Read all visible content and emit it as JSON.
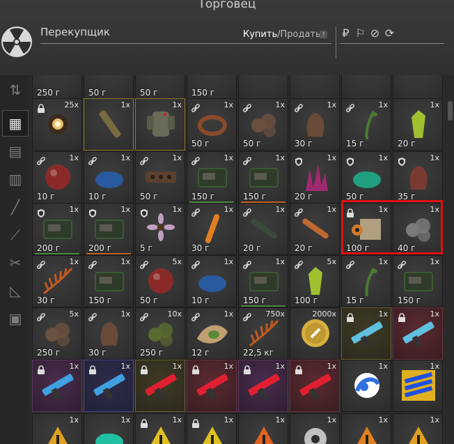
{
  "window": {
    "title": "Торговец"
  },
  "header": {
    "trader_name": "Перекупщик",
    "mode_buy": "Купить",
    "mode_sep": "/",
    "mode_sell": "Продать",
    "help": "?",
    "currencies": [
      "₽",
      "⚐",
      "⊘",
      "⟳"
    ]
  },
  "sidebar": {
    "items": [
      {
        "icon": "sort-icon",
        "active": false
      },
      {
        "icon": "grid-all-icon",
        "active": true
      },
      {
        "icon": "backpack-icon",
        "active": false
      },
      {
        "icon": "armor-icon",
        "active": false
      },
      {
        "icon": "rifle-icon",
        "active": false
      },
      {
        "icon": "knife-icon",
        "active": false
      },
      {
        "icon": "tools-icon",
        "active": false
      },
      {
        "icon": "attachments-icon",
        "active": false
      },
      {
        "icon": "crate-icon",
        "active": false
      }
    ]
  },
  "grid": {
    "rows": [
      [
        {
          "price": "250 г"
        },
        {
          "price": "50 г"
        },
        {
          "price": "50 г"
        },
        {
          "price": "150 г"
        },
        {
          "price": ""
        },
        {
          "price": ""
        },
        {
          "price": ""
        },
        {
          "price": ""
        }
      ],
      [
        {
          "qty": "25x",
          "price": "",
          "badge": "lock",
          "art": "orb",
          "color": "#e8c070"
        },
        {
          "qty": "1x",
          "price": "",
          "badge": "",
          "art": "rod",
          "color": "#7a6a40",
          "tone": "y"
        },
        {
          "qty": "1x",
          "price": "",
          "badge": "",
          "art": "armor",
          "color": "#6a6a58",
          "tone": "y"
        },
        {
          "qty": "1x",
          "price": "50 г",
          "badge": "link",
          "art": "ring",
          "color": "#8a4a2a"
        },
        {
          "qty": "1x",
          "price": "50 г",
          "badge": "link",
          "art": "rocks",
          "color": "#6a5040"
        },
        {
          "qty": "1x",
          "price": "30 г",
          "badge": "link",
          "art": "lump",
          "color": "#6a4a38"
        },
        {
          "qty": "1x",
          "price": "15 г",
          "badge": "link",
          "art": "sprout",
          "color": "#4a7a30"
        },
        {
          "qty": "1x",
          "price": "20 г",
          "badge": "",
          "art": "crystal",
          "color": "#a0c030"
        }
      ],
      [
        {
          "qty": "1x",
          "price": "10 г",
          "badge": "link",
          "art": "sphere",
          "color": "#8a2a28"
        },
        {
          "qty": "1x",
          "price": "10 г",
          "badge": "link",
          "art": "moss",
          "color": "#2a5aa0"
        },
        {
          "qty": "1x",
          "price": "50 г",
          "badge": "link",
          "art": "slab",
          "color": "#5a4030"
        },
        {
          "qty": "1x",
          "price": "150 г",
          "badge": "link",
          "art": "board",
          "color": "#3a5a30",
          "ul": "#4a8a40"
        },
        {
          "qty": "1x",
          "price": "150 г",
          "badge": "link",
          "art": "board",
          "color": "#3a5a30",
          "ul": "#c06020"
        },
        {
          "qty": "1x",
          "price": "20 г",
          "badge": "shield",
          "art": "crystals",
          "color": "#a02a70"
        },
        {
          "qty": "1x",
          "price": "50 г",
          "badge": "shield",
          "art": "moss",
          "color": "#20a080"
        },
        {
          "qty": "1x",
          "price": "35 г",
          "badge": "shield",
          "art": "lump",
          "color": "#7a3a30"
        }
      ],
      [
        {
          "qty": "1x",
          "price": "200 г",
          "badge": "shield",
          "art": "board",
          "color": "#3a5a30",
          "ul": "#4a8a40"
        },
        {
          "qty": "1x",
          "price": "200 г",
          "badge": "shield",
          "art": "board",
          "color": "#3a5a30",
          "ul": "#c06020"
        },
        {
          "qty": "1x",
          "price": "5 г",
          "badge": "shield",
          "art": "flower",
          "color": "#c0a0c0"
        },
        {
          "qty": "1x",
          "price": "30 г",
          "badge": "link",
          "art": "stick",
          "color": "#e08020"
        },
        {
          "qty": "1x",
          "price": "20 г",
          "badge": "link",
          "art": "tube",
          "color": "#3a4a3a"
        },
        {
          "qty": "1x",
          "price": "20 г",
          "badge": "link",
          "art": "tube",
          "color": "#c06a30"
        },
        {
          "qty": "1x",
          "price": "100 г",
          "badge": "lock",
          "art": "box",
          "color": "#d07a2a"
        },
        {
          "qty": "1x",
          "price": "40 г",
          "badge": "",
          "art": "rocks",
          "color": "#7a7a7a"
        }
      ],
      [
        {
          "qty": "1x",
          "price": "30 г",
          "badge": "link",
          "art": "fern",
          "color": "#c05a20"
        },
        {
          "qty": "1x",
          "price": "150 г",
          "badge": "link",
          "art": "board",
          "color": "#3a5a30"
        },
        {
          "qty": "5x",
          "price": "50 г",
          "badge": "link",
          "art": "sphere",
          "color": "#8a2a28"
        },
        {
          "qty": "1x",
          "price": "10 г",
          "badge": "link",
          "art": "moss",
          "color": "#2a5aa0"
        },
        {
          "qty": "1x",
          "price": "150 г",
          "badge": "link",
          "art": "board",
          "color": "#3a5a30",
          "ul": "#4a8a40"
        },
        {
          "qty": "5x",
          "price": "100 г",
          "badge": "link",
          "art": "crystal",
          "color": "#a0c030"
        },
        {
          "qty": "1x",
          "price": "15 г",
          "badge": "link",
          "art": "sprout",
          "color": "#4a7a30"
        },
        {
          "qty": "1x",
          "price": "150 г",
          "badge": "link",
          "art": "board",
          "color": "#3a5a30"
        }
      ],
      [
        {
          "qty": "5x",
          "price": "250 г",
          "badge": "link",
          "art": "rocks",
          "color": "#6a5040"
        },
        {
          "qty": "1x",
          "price": "30 г",
          "badge": "link",
          "art": "lump",
          "color": "#6a4a38"
        },
        {
          "qty": "10x",
          "price": "250 г",
          "badge": "link",
          "art": "rocks",
          "color": "#5a6a30"
        },
        {
          "qty": "1x",
          "price": "12 г",
          "badge": "link",
          "art": "leaf",
          "color": "#c0a070"
        },
        {
          "qty": "750x",
          "price": "22,5 кг",
          "badge": "link",
          "art": "fern",
          "color": "#c05a20"
        },
        {
          "qty": "2000x",
          "price": "",
          "badge": "",
          "art": "coin",
          "color": "#d8b040"
        },
        {
          "qty": "1x",
          "price": "",
          "badge": "lock",
          "art": "gun",
          "color": "#60c0e0",
          "tone": "g"
        },
        {
          "qty": "1x",
          "price": "",
          "badge": "lock",
          "art": "gun",
          "color": "#60c0e0",
          "tone": "r"
        }
      ],
      [
        {
          "qty": "1x",
          "price": "",
          "badge": "lock",
          "art": "gun",
          "color": "#40a0e0",
          "tone": "m"
        },
        {
          "qty": "1x",
          "price": "",
          "badge": "lock",
          "art": "gun",
          "color": "#40a0e0",
          "tone": "b"
        },
        {
          "qty": "1x",
          "price": "",
          "badge": "lock",
          "art": "gun",
          "color": "#e02030",
          "tone": "g"
        },
        {
          "qty": "1x",
          "price": "",
          "badge": "lock",
          "art": "gun",
          "color": "#e02030",
          "tone": "r"
        },
        {
          "qty": "1x",
          "price": "",
          "badge": "lock",
          "art": "gun",
          "color": "#e02030",
          "tone": "m"
        },
        {
          "qty": "1x",
          "price": "",
          "badge": "lock",
          "art": "gun",
          "color": "#e02030",
          "tone": "r"
        },
        {
          "qty": "1x",
          "price": "",
          "badge": "",
          "art": "swirl",
          "color": "#3070e0"
        },
        {
          "qty": "1x",
          "price": "",
          "badge": "",
          "art": "stripes",
          "color": "#2050e0"
        }
      ],
      [
        {
          "qty": "1x",
          "price": "",
          "badge": "",
          "art": "warn",
          "color": "#e0a020"
        },
        {
          "qty": "1x",
          "price": "",
          "badge": "",
          "art": "moss",
          "color": "#20c0a0"
        },
        {
          "qty": "1x",
          "price": "",
          "badge": "lock",
          "art": "warn",
          "color": "#e0c020"
        },
        {
          "qty": "1x",
          "price": "",
          "badge": "lock",
          "art": "warn",
          "color": "#e0c020"
        },
        {
          "qty": "1x",
          "price": "",
          "badge": "",
          "art": "warn",
          "color": "#e06020"
        },
        {
          "qty": "1x",
          "price": "",
          "badge": "",
          "art": "gear",
          "color": "#c0c0c0"
        },
        {
          "qty": "1x",
          "price": "",
          "badge": "",
          "art": "warn",
          "color": "#e08020"
        },
        {
          "qty": "1x",
          "price": "",
          "badge": "",
          "art": "warn",
          "color": "#e0a020"
        }
      ]
    ]
  }
}
